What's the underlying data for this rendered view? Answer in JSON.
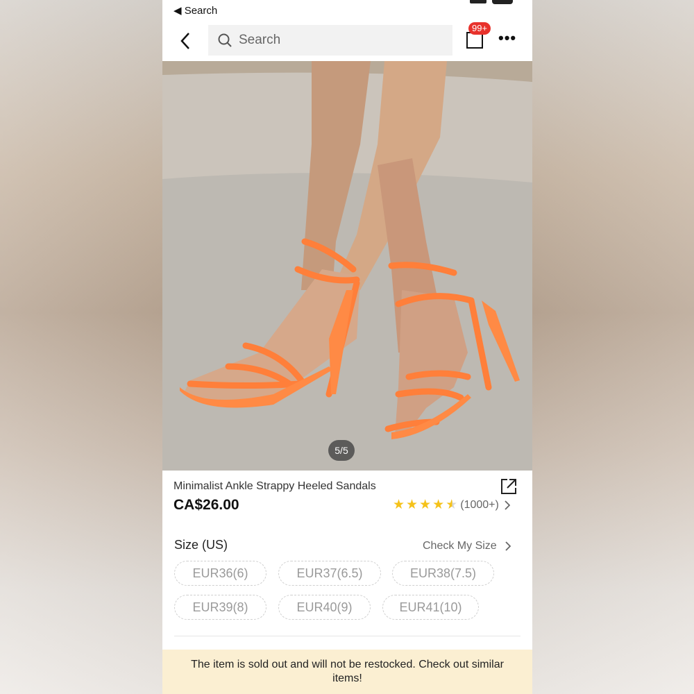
{
  "status_bar": {
    "back_label": "◀ Search"
  },
  "topbar": {
    "search_placeholder": "Search",
    "cart_badge": "99+",
    "more_label": "•••"
  },
  "gallery": {
    "page_indicator": "5/5"
  },
  "product": {
    "title": "Minimalist Ankle Strappy Heeled Sandals",
    "price": "CA$26.00",
    "rating_stars": 4.5,
    "rating_count": "(1000+)"
  },
  "size_section": {
    "label": "Size (US)",
    "check_size_label": "Check My Size",
    "options": [
      "EUR36(6)",
      "EUR37(6.5)",
      "EUR38(7.5)",
      "EUR39(8)",
      "EUR40(9)",
      "EUR41(10)"
    ]
  },
  "notice": {
    "text": "The item is sold out and will not be restocked. Check out similar items!"
  },
  "colors": {
    "accent_star": "#f5c21a",
    "badge": "#e8322c",
    "notice_bg": "#fbefd2"
  }
}
